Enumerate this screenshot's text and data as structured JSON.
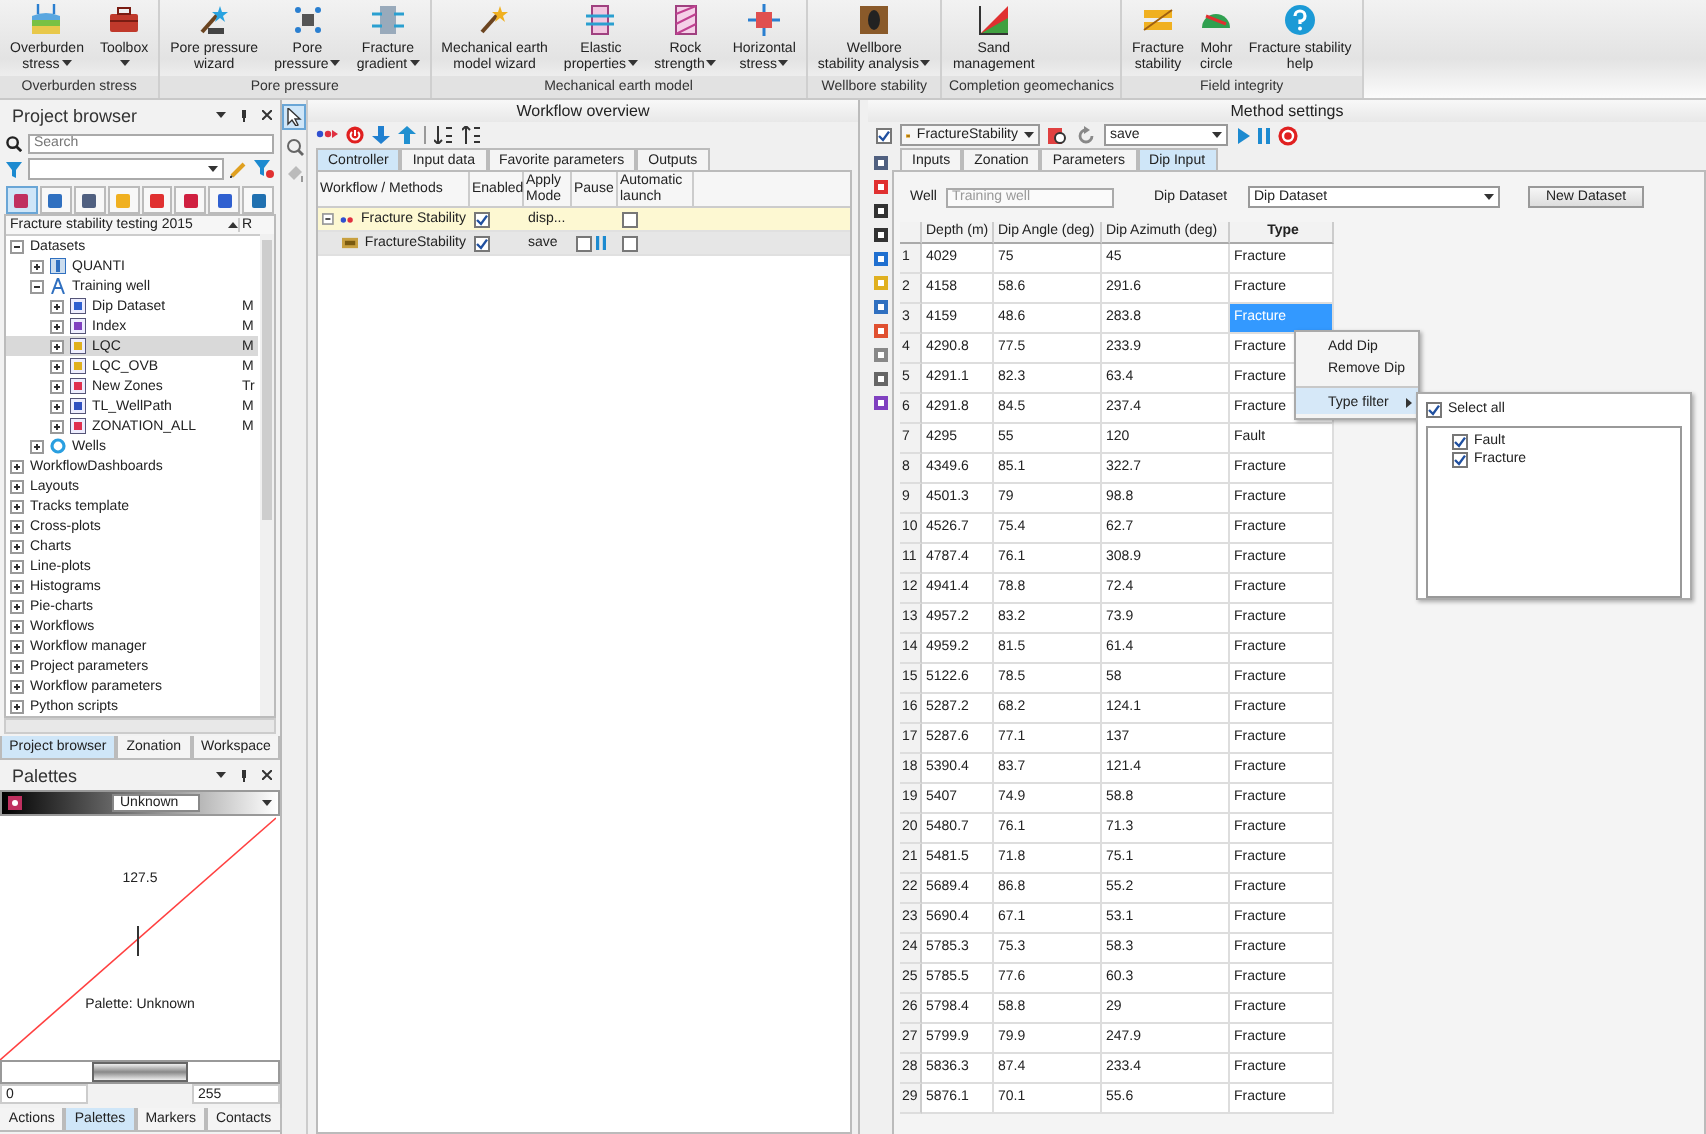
{
  "ribbon": {
    "groups": [
      {
        "label": "Overburden stress",
        "buttons": [
          {
            "lines": [
              "Overburden",
              "stress"
            ],
            "dropdown": true
          },
          {
            "lines": [
              "Toolbox"
            ],
            "dropdown": true
          }
        ]
      },
      {
        "label": "Pore pressure",
        "buttons": [
          {
            "lines": [
              "Pore pressure",
              "wizard"
            ],
            "dropdown": false
          },
          {
            "lines": [
              "Pore",
              "pressure"
            ],
            "dropdown": true
          },
          {
            "lines": [
              "Fracture",
              "gradient"
            ],
            "dropdown": true
          }
        ]
      },
      {
        "label": "Mechanical earth model",
        "buttons": [
          {
            "lines": [
              "Mechanical earth",
              "model wizard"
            ],
            "dropdown": false
          },
          {
            "lines": [
              "Elastic",
              "properties"
            ],
            "dropdown": true
          },
          {
            "lines": [
              "Rock",
              "strength"
            ],
            "dropdown": true
          },
          {
            "lines": [
              "Horizontal",
              "stress"
            ],
            "dropdown": true
          }
        ]
      },
      {
        "label": "Wellbore stability",
        "buttons": [
          {
            "lines": [
              "Wellbore",
              "stability analysis"
            ],
            "dropdown": true
          }
        ]
      },
      {
        "label": "Completion geomechanics",
        "buttons": [
          {
            "lines": [
              "Sand",
              "management"
            ],
            "dropdown": false
          }
        ]
      },
      {
        "label": "Field integrity",
        "buttons": [
          {
            "lines": [
              "Fracture",
              "stability"
            ],
            "dropdown": false
          },
          {
            "lines": [
              "Mohr",
              "circle"
            ],
            "dropdown": false
          },
          {
            "lines": [
              "Fracture stability",
              "help"
            ],
            "dropdown": false
          }
        ]
      }
    ]
  },
  "project_browser": {
    "title": "Project browser",
    "search": {
      "placeholder": "Search"
    },
    "tree": {
      "header": "Fracture stability testing 2015",
      "column_2_header": "R",
      "items": [
        {
          "label": "Datasets",
          "expanded": true,
          "selected": false,
          "children": [
            {
              "label": "QUANTI",
              "expanded": false,
              "selected": false
            },
            {
              "label": "Training well",
              "expanded": true,
              "selected": false,
              "children": [
                {
                  "label": "Dip Dataset",
                  "column_2": "M",
                  "expanded": false,
                  "selected": false
                },
                {
                  "label": "Index",
                  "column_2": "M",
                  "expanded": false,
                  "selected": false
                },
                {
                  "label": "LQC",
                  "column_2": "M",
                  "expanded": false,
                  "selected": true
                },
                {
                  "label": "LQC_OVB",
                  "column_2": "M",
                  "expanded": false,
                  "selected": false
                },
                {
                  "label": "New Zones",
                  "column_2": "Tr",
                  "expanded": false,
                  "selected": false
                },
                {
                  "label": "TL_WellPath",
                  "column_2": "M",
                  "expanded": false,
                  "selected": false
                },
                {
                  "label": "ZONATION_ALL",
                  "column_2": "M",
                  "expanded": false,
                  "selected": false
                }
              ]
            },
            {
              "label": "Wells",
              "expanded": false,
              "selected": false
            }
          ]
        },
        {
          "label": "WorkflowDashboards",
          "expanded": false,
          "selected": false
        },
        {
          "label": "Layouts",
          "expanded": false,
          "selected": false
        },
        {
          "label": "Tracks template",
          "expanded": false,
          "selected": false
        },
        {
          "label": "Cross-plots",
          "expanded": false,
          "selected": false
        },
        {
          "label": "Charts",
          "expanded": false,
          "selected": false
        },
        {
          "label": "Line-plots",
          "expanded": false,
          "selected": false
        },
        {
          "label": "Histograms",
          "expanded": false,
          "selected": false
        },
        {
          "label": "Pie-charts",
          "expanded": false,
          "selected": false
        },
        {
          "label": "Workflows",
          "expanded": false,
          "selected": false
        },
        {
          "label": "Workflow manager",
          "expanded": false,
          "selected": false
        },
        {
          "label": "Project parameters",
          "expanded": false,
          "selected": false
        },
        {
          "label": "Workflow parameters",
          "expanded": false,
          "selected": false
        },
        {
          "label": "Python scripts",
          "expanded": false,
          "selected": false
        }
      ]
    },
    "tabs": [
      {
        "label": "Project browser",
        "selected": true
      },
      {
        "label": "Zonation",
        "selected": false
      },
      {
        "label": "Workspace",
        "selected": false
      }
    ]
  },
  "palettes": {
    "title": "Palettes",
    "palette": "Unknown",
    "mid_value": "127.5",
    "caption": "Palette: Unknown",
    "min": "0",
    "max": "255",
    "tabs": [
      {
        "label": "Actions",
        "selected": false
      },
      {
        "label": "Palettes",
        "selected": true
      },
      {
        "label": "Markers",
        "selected": false
      },
      {
        "label": "Contacts",
        "selected": false
      }
    ]
  },
  "workflow_overview": {
    "title": "Workflow overview",
    "tabs": [
      {
        "label": "Controller",
        "selected": true
      },
      {
        "label": "Input data",
        "selected": false
      },
      {
        "label": "Favorite parameters",
        "selected": false
      },
      {
        "label": "Outputs",
        "selected": false
      }
    ],
    "columns": [
      "Workflow / Methods",
      "Enabled",
      "Apply Mode",
      "Pause",
      "Automatic launch"
    ],
    "rows": [
      {
        "name": "Fracture Stability",
        "expanded": true,
        "selected": true,
        "enabled": true,
        "mode": "disp...",
        "automatic": false,
        "children": [
          {
            "name": "FractureStability",
            "selected": false,
            "enabled": true,
            "mode": "save",
            "paused": false,
            "automatic": false
          }
        ]
      }
    ]
  },
  "method_settings": {
    "title": "Method settings",
    "enabled": true,
    "method": "FractureStability",
    "mode": "save",
    "tabs": [
      {
        "label": "Inputs",
        "selected": false
      },
      {
        "label": "Zonation",
        "selected": false
      },
      {
        "label": "Parameters",
        "selected": false
      },
      {
        "label": "Dip Input",
        "selected": true
      }
    ],
    "well_label": "Well",
    "well": {
      "value": "Training well",
      "disabled": true
    },
    "dataset_label": "Dip Dataset",
    "dataset": "Dip Dataset",
    "new_button": "New Dataset",
    "columns": [
      "Depth (m)",
      "Dip Angle (deg)",
      "Dip Azimuth (deg)",
      "Type"
    ],
    "rows": [
      {
        "number": "1",
        "depth": "4029",
        "angle": "75",
        "azimuth": "45",
        "type": "Fracture",
        "selected": false
      },
      {
        "number": "2",
        "depth": "4158",
        "angle": "58.6",
        "azimuth": "291.6",
        "type": "Fracture",
        "selected": false
      },
      {
        "number": "3",
        "depth": "4159",
        "angle": "48.6",
        "azimuth": "283.8",
        "type": "Fracture",
        "selected": true
      },
      {
        "number": "4",
        "depth": "4290.8",
        "angle": "77.5",
        "azimuth": "233.9",
        "type": "Fracture",
        "selected": false
      },
      {
        "number": "5",
        "depth": "4291.1",
        "angle": "82.3",
        "azimuth": "63.4",
        "type": "Fracture",
        "selected": false
      },
      {
        "number": "6",
        "depth": "4291.8",
        "angle": "84.5",
        "azimuth": "237.4",
        "type": "Fracture",
        "selected": false
      },
      {
        "number": "7",
        "depth": "4295",
        "angle": "55",
        "azimuth": "120",
        "type": "Fault",
        "selected": false
      },
      {
        "number": "8",
        "depth": "4349.6",
        "angle": "85.1",
        "azimuth": "322.7",
        "type": "Fracture",
        "selected": false
      },
      {
        "number": "9",
        "depth": "4501.3",
        "angle": "79",
        "azimuth": "98.8",
        "type": "Fracture",
        "selected": false
      },
      {
        "number": "10",
        "depth": "4526.7",
        "angle": "75.4",
        "azimuth": "62.7",
        "type": "Fracture",
        "selected": false
      },
      {
        "number": "11",
        "depth": "4787.4",
        "angle": "76.1",
        "azimuth": "308.9",
        "type": "Fracture",
        "selected": false
      },
      {
        "number": "12",
        "depth": "4941.4",
        "angle": "78.8",
        "azimuth": "72.4",
        "type": "Fracture",
        "selected": false
      },
      {
        "number": "13",
        "depth": "4957.2",
        "angle": "83.2",
        "azimuth": "73.9",
        "type": "Fracture",
        "selected": false
      },
      {
        "number": "14",
        "depth": "4959.2",
        "angle": "81.5",
        "azimuth": "61.4",
        "type": "Fracture",
        "selected": false
      },
      {
        "number": "15",
        "depth": "5122.6",
        "angle": "78.5",
        "azimuth": "58",
        "type": "Fracture",
        "selected": false
      },
      {
        "number": "16",
        "depth": "5287.2",
        "angle": "68.2",
        "azimuth": "124.1",
        "type": "Fracture",
        "selected": false
      },
      {
        "number": "17",
        "depth": "5287.6",
        "angle": "77.1",
        "azimuth": "137",
        "type": "Fracture",
        "selected": false
      },
      {
        "number": "18",
        "depth": "5390.4",
        "angle": "83.7",
        "azimuth": "121.4",
        "type": "Fracture",
        "selected": false
      },
      {
        "number": "19",
        "depth": "5407",
        "angle": "74.9",
        "azimuth": "58.8",
        "type": "Fracture",
        "selected": false
      },
      {
        "number": "20",
        "depth": "5480.7",
        "angle": "76.1",
        "azimuth": "71.3",
        "type": "Fracture",
        "selected": false
      },
      {
        "number": "21",
        "depth": "5481.5",
        "angle": "71.8",
        "azimuth": "75.1",
        "type": "Fracture",
        "selected": false
      },
      {
        "number": "22",
        "depth": "5689.4",
        "angle": "86.8",
        "azimuth": "55.2",
        "type": "Fracture",
        "selected": false
      },
      {
        "number": "23",
        "depth": "5690.4",
        "angle": "67.1",
        "azimuth": "53.1",
        "type": "Fracture",
        "selected": false
      },
      {
        "number": "24",
        "depth": "5785.3",
        "angle": "75.3",
        "azimuth": "58.3",
        "type": "Fracture",
        "selected": false
      },
      {
        "number": "25",
        "depth": "5785.5",
        "angle": "77.6",
        "azimuth": "60.3",
        "type": "Fracture",
        "selected": false
      },
      {
        "number": "26",
        "depth": "5798.4",
        "angle": "58.8",
        "azimuth": "29",
        "type": "Fracture",
        "selected": false
      },
      {
        "number": "27",
        "depth": "5799.9",
        "angle": "79.9",
        "azimuth": "247.9",
        "type": "Fracture",
        "selected": false
      },
      {
        "number": "28",
        "depth": "5836.3",
        "angle": "87.4",
        "azimuth": "233.4",
        "type": "Fracture",
        "selected": false
      },
      {
        "number": "29",
        "depth": "5876.1",
        "angle": "70.1",
        "azimuth": "55.6",
        "type": "Fracture",
        "selected": false
      }
    ],
    "context_menu": {
      "items": [
        {
          "label": "Add Dip",
          "submenu": false,
          "separator_before": false,
          "selected": false
        },
        {
          "label": "Remove Dip",
          "submenu": false,
          "separator_before": false,
          "selected": false
        },
        {
          "label": "Type filter",
          "submenu": true,
          "separator_before": true,
          "selected": true
        }
      ]
    },
    "type_filter": {
      "select_all": {
        "label": "Select all",
        "checked": true
      },
      "items": [
        {
          "label": "Fault",
          "checked": true
        },
        {
          "label": "Fracture",
          "checked": true
        }
      ]
    }
  }
}
